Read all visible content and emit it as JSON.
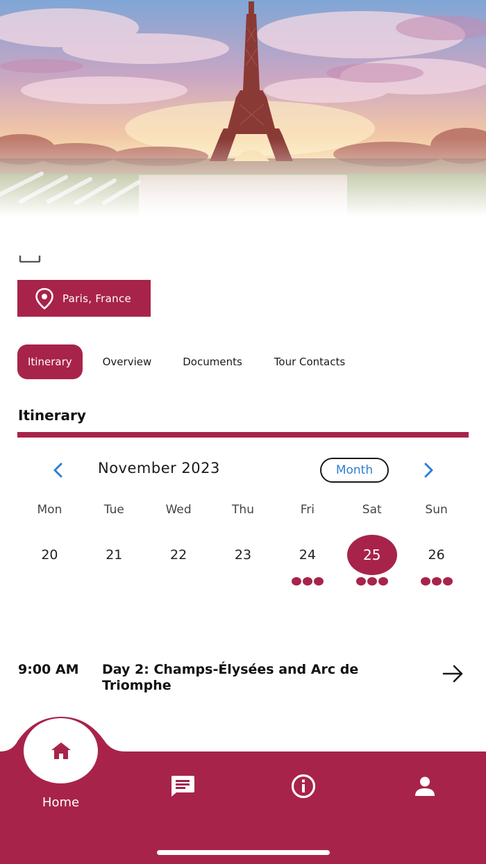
{
  "hero": {
    "image": "eiffel-tower-paris-photo"
  },
  "location": {
    "label": "Paris, France",
    "icon": "map-pin-icon"
  },
  "tabs": [
    {
      "label": "Itinerary",
      "active": true
    },
    {
      "label": "Overview",
      "active": false
    },
    {
      "label": "Documents",
      "active": false
    },
    {
      "label": "Tour Contacts",
      "active": false
    }
  ],
  "section": {
    "title": "Itinerary"
  },
  "calendar": {
    "month_label": "November 2023",
    "view_toggle": "Month",
    "weekdays": [
      "Mon",
      "Tue",
      "Wed",
      "Thu",
      "Fri",
      "Sat",
      "Sun"
    ],
    "dates": [
      "20",
      "21",
      "22",
      "23",
      "24",
      "25",
      "26"
    ],
    "selected_date": "25",
    "dates_with_events": [
      "24",
      "25",
      "26"
    ]
  },
  "itinerary_item": {
    "time": "9:00 AM",
    "title": "Day 2: Champs-Élysées and Arc de Triomphe"
  },
  "bottom_nav": {
    "home_label": "Home",
    "items": [
      "home-icon",
      "message-icon",
      "info-icon",
      "profile-icon"
    ]
  },
  "colors": {
    "brand": "#a8234a",
    "link_blue": "#2d7fd3"
  }
}
